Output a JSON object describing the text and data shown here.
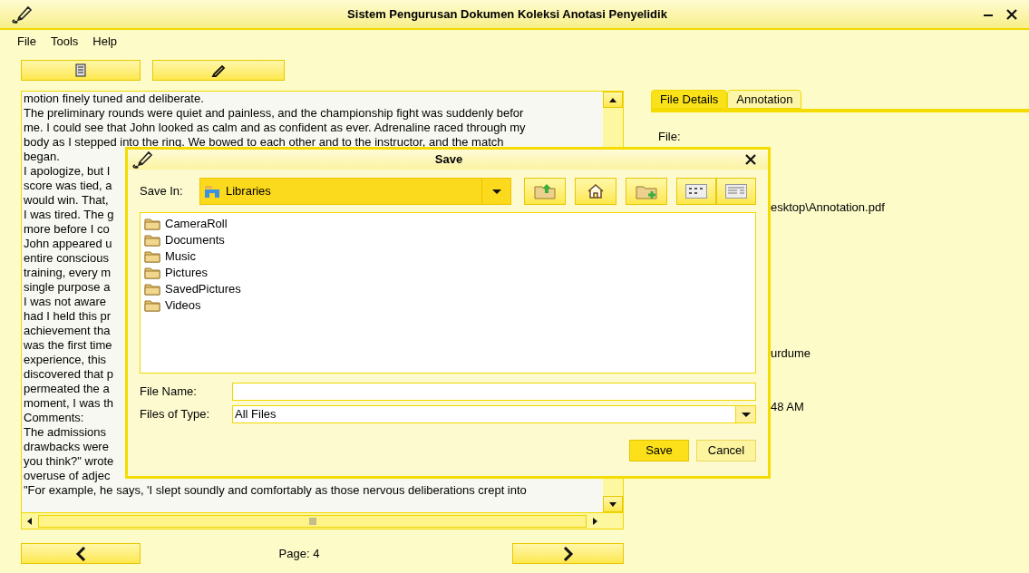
{
  "window": {
    "title": "Sistem Pengurusan Dokumen Koleksi Anotasi Penyelidik"
  },
  "menu": [
    "File",
    "Tools",
    "Help"
  ],
  "document_lines": [
    "motion finely tuned and deliberate.",
    "The preliminary rounds were quiet and painless, and the championship fight was suddenly befor",
    "me. I could see that John looked as calm and as confident as ever. Adrenaline raced through my",
    "body as I stepped into the ring. We bowed to each other and to the instructor, and the match",
    "began.",
    "I apologize, but I",
    "score was tied, a",
    "would win. That,",
    "I was tired. The g",
    "more before I co",
    "John appeared u",
    "entire conscious",
    "training, every m",
    "single purpose a",
    "I was not aware",
    "had I held this pr",
    "achievement tha",
    "was the first time",
    "experience, this",
    "discovered that p",
    "permeated the a",
    "moment, I was th",
    "Comments:",
    "The admissions",
    "drawbacks were",
    "you think?\" wrote",
    "overuse of adjec",
    "\"For example, he says, 'I slept soundly and comfortably as those nervous deliberations crept into"
  ],
  "page_label": "Page: 4",
  "tabs": [
    {
      "label": "File Details",
      "selected": true
    },
    {
      "label": "Annotation",
      "selected": false
    }
  ],
  "details": [
    "File:",
    "esktop\\Annotation.pdf",
    "urdume",
    "48 AM"
  ],
  "dialog": {
    "title": "Save",
    "save_in_label": "Save In:",
    "save_in_value": "Libraries",
    "folders": [
      "CameraRoll",
      "Documents",
      "Music",
      "Pictures",
      "SavedPictures",
      "Videos"
    ],
    "file_name_label": "File Name:",
    "file_type_label": "Files of Type:",
    "file_type_value": "All Files",
    "buttons": [
      {
        "label": "Save",
        "selected": true
      },
      {
        "label": "Cancel",
        "selected": false
      }
    ]
  }
}
